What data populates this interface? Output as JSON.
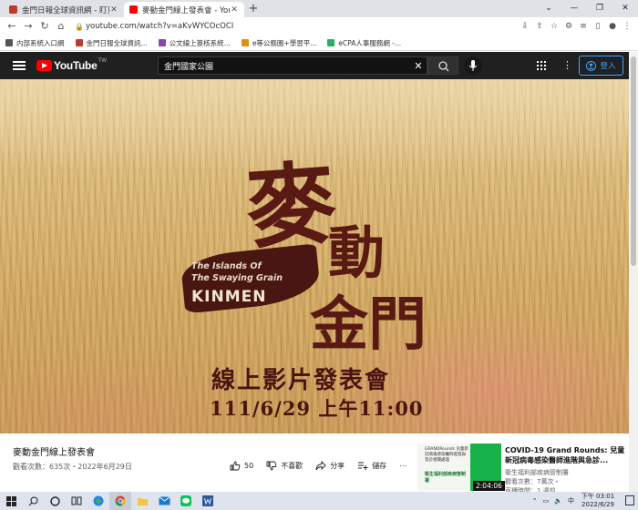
{
  "browser": {
    "tabs": [
      {
        "title": "金門日報全球資訊網 - 盯覓電子報",
        "favicon_color": "#c0392b",
        "active": false
      },
      {
        "title": "麥動金門線上發表會 - YouTube",
        "favicon_color": "#ff0000",
        "active": true
      }
    ],
    "new_tab_glyph": "+",
    "url": "youtube.com/watch?v=aKvWYCOcOCI",
    "bookmarks": [
      {
        "label": "内部系統入口網",
        "color": "#555"
      },
      {
        "label": "金門日報全球資訊...",
        "color": "#c0392b"
      },
      {
        "label": "公文線上簽核系統...",
        "color": "#8e44ad"
      },
      {
        "label": "e等公務園+學習平...",
        "color": "#e08e0b"
      },
      {
        "label": "eCPA人事服務網 -...",
        "color": "#27ae60"
      }
    ]
  },
  "youtube": {
    "logo_text": "YouTube",
    "logo_region": "TW",
    "search_value": "金門國家公園",
    "signin_label": "登入"
  },
  "video": {
    "art_title_main": "麥",
    "art_title_2": "動",
    "art_title_3": "金門",
    "en_line1": "The Islands Of",
    "en_line2": "The Swaying Grain",
    "en_line3": "KINMEN",
    "launch_title": "線上影片發表會",
    "launch_datetime": "111/6/29  上午11:00",
    "title": "麥動金門線上發表會",
    "meta": "觀看次數：635次・2022年6月29日",
    "likes": "50",
    "dislike_label": "不喜歡",
    "share_label": "分享",
    "save_label": "儲存",
    "more_glyph": "⋯"
  },
  "recommended": {
    "title": "COVID-19 Grand Rounds: 兒童新冠病毒感染醫師進階與急診...",
    "channel": "衛生福利部疾病管制署",
    "views": "觀看次數：7萬次・",
    "time": "直播時間：1 週前",
    "duration": "2:04:06",
    "thumb_text1": "GRANDRounds 兒童新冠病毒感染醫師進階與急診相關處理",
    "thumb_text2": "衛生福利部疾病管制署"
  },
  "taskbar": {
    "ime": "中",
    "time": "下午 03:01",
    "date": "2022/6/29"
  }
}
